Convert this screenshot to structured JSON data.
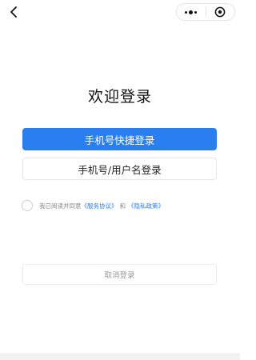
{
  "nav": {
    "back_icon": "chevron-left-icon",
    "menu_icon": "more-dots-icon",
    "close_icon": "target-circle-icon"
  },
  "login": {
    "title": "欢迎登录",
    "phone_quick_login": "手机号快捷登录",
    "account_login": "手机号/用户名登录"
  },
  "agreement": {
    "checked": false,
    "prefix": "我已阅读并同意",
    "service_agreement": "《服务协议》",
    "and": "和",
    "privacy_policy": "《隐私政策》"
  },
  "cancel": {
    "label": "取消登录"
  },
  "colors": {
    "accent": "#2a7ef0",
    "muted_text": "#888888"
  }
}
